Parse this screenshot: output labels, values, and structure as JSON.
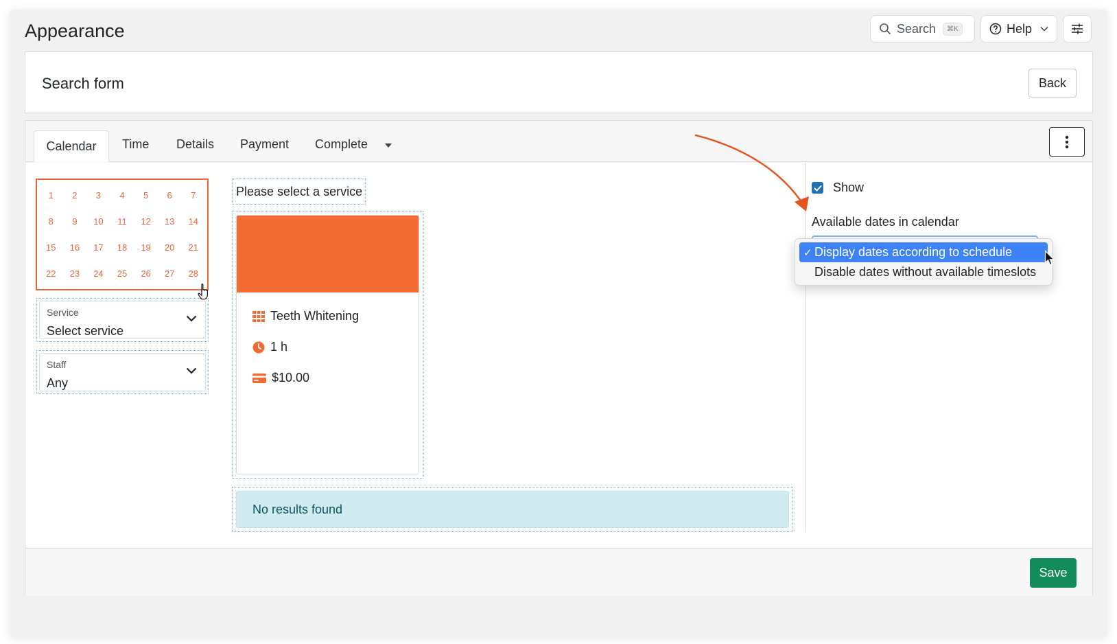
{
  "header": {
    "title": "Appearance"
  },
  "top_actions": {
    "search_label": "Search",
    "search_shortcut": "⌘K",
    "help_label": "Help"
  },
  "search_form": {
    "title": "Search form",
    "back_label": "Back"
  },
  "tabs": [
    {
      "label": "Calendar",
      "active": true
    },
    {
      "label": "Time"
    },
    {
      "label": "Details"
    },
    {
      "label": "Payment"
    },
    {
      "label": "Complete"
    }
  ],
  "calendar": {
    "days": [
      "1",
      "2",
      "3",
      "4",
      "5",
      "6",
      "7",
      "8",
      "9",
      "10",
      "11",
      "12",
      "13",
      "14",
      "15",
      "16",
      "17",
      "18",
      "19",
      "20",
      "21",
      "22",
      "23",
      "24",
      "25",
      "26",
      "27",
      "28"
    ]
  },
  "service_select": {
    "label": "Service",
    "value": "Select service"
  },
  "staff_select": {
    "label": "Staff",
    "value": "Any"
  },
  "prompt": "Please select a service",
  "service_card": {
    "name": "Teeth Whitening",
    "duration": "1 h",
    "price": "$10.00"
  },
  "results": {
    "message": "No results found"
  },
  "settings": {
    "show_label": "Show",
    "show_checked": true,
    "available_dates_label": "Available dates in calendar",
    "options": [
      {
        "label": "Display dates according to schedule",
        "selected": true,
        "check": "✓"
      },
      {
        "label": "Disable dates without available timeslots",
        "selected": false
      }
    ]
  },
  "footer": {
    "save_label": "Save"
  },
  "colors": {
    "accent_orange": "#f26b33",
    "calendar_orange": "#e8663a",
    "save_green": "#138c5b",
    "checkbox_blue": "#2271b1",
    "selected_option_blue": "#3d82f7",
    "info_bg": "#d1ecf1"
  }
}
